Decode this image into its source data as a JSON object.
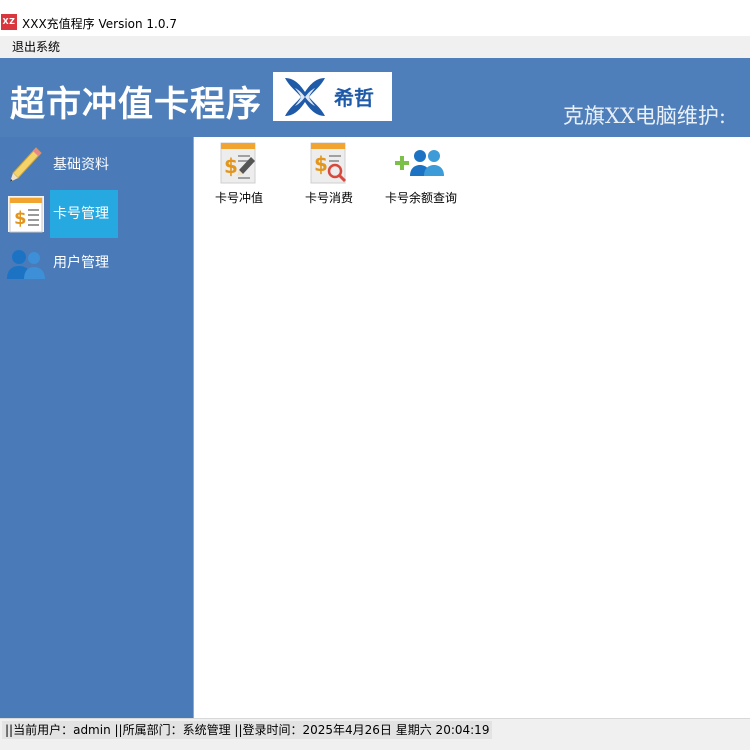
{
  "window": {
    "icon_text": "XZ",
    "title": "XXX充值程序 Version 1.0.7"
  },
  "menu": {
    "items": [
      {
        "label": "退出系统"
      }
    ]
  },
  "banner": {
    "title": "超市冲值卡程序",
    "logo_text": "希哲",
    "maintainer": "克旗XX电脑维护:"
  },
  "sidebar": {
    "items": [
      {
        "label": "基础资料",
        "icon": "pencil-icon",
        "active": false
      },
      {
        "label": "卡号管理",
        "icon": "money-document-icon",
        "active": true
      },
      {
        "label": "用户管理",
        "icon": "users-icon",
        "active": false
      }
    ]
  },
  "main": {
    "tiles": [
      {
        "label": "卡号冲值",
        "icon": "money-document-pen-icon"
      },
      {
        "label": "卡号消费",
        "icon": "money-document-search-icon"
      },
      {
        "label": "卡号余额查询",
        "icon": "add-users-icon"
      }
    ]
  },
  "status": {
    "text": "||当前用户：admin  ||所属部门：系统管理  ||登录时间：2025年4月26日 星期六 20:04:19"
  },
  "colors": {
    "banner": "#4f7fba",
    "sidebar": "#4a7ab8",
    "active_item": "#26a9e0",
    "logo_blue": "#1e5aa8"
  }
}
